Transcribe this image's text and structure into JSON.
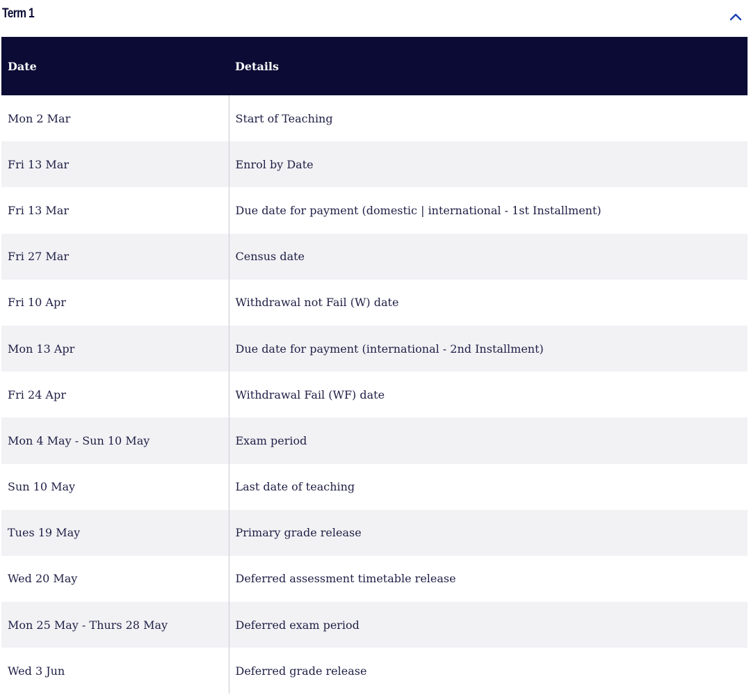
{
  "accordion": {
    "title": "Term 1",
    "expanded": true,
    "toggle_icon": "chevron-up-icon"
  },
  "table": {
    "headers": {
      "date": "Date",
      "details": "Details"
    },
    "rows": [
      {
        "date": "Mon 2 Mar",
        "details": "Start of Teaching"
      },
      {
        "date": "Fri 13 Mar",
        "details": "Enrol by Date"
      },
      {
        "date": "Fri 13 Mar",
        "details": "Due date for payment (domestic | international - 1st Installment)"
      },
      {
        "date": "Fri 27 Mar",
        "details": "Census date"
      },
      {
        "date": "Fri 10 Apr",
        "details": "Withdrawal not Fail (W) date"
      },
      {
        "date": "Mon 13 Apr",
        "details": "Due date for payment (international - 2nd Installment)"
      },
      {
        "date": "Fri 24 Apr",
        "details": "Withdrawal Fail (WF) date"
      },
      {
        "date": "Mon 4 May - Sun 10 May",
        "details": "Exam period"
      },
      {
        "date": "Sun 10 May",
        "details": "Last date of teaching"
      },
      {
        "date": "Tues 19 May",
        "details": "Primary grade release"
      },
      {
        "date": "Wed 20 May",
        "details": "Deferred assessment timetable release"
      },
      {
        "date": "Mon 25 May - Thurs 28 May",
        "details": "Deferred exam period"
      },
      {
        "date": "Wed 3 Jun",
        "details": "Deferred grade release"
      }
    ]
  },
  "colors": {
    "header_bg": "#0b0b35",
    "header_text": "#ffffff",
    "stripe_bg": "#f2f2f5",
    "text": "#1e1e45",
    "accent": "#1a3fb0"
  }
}
